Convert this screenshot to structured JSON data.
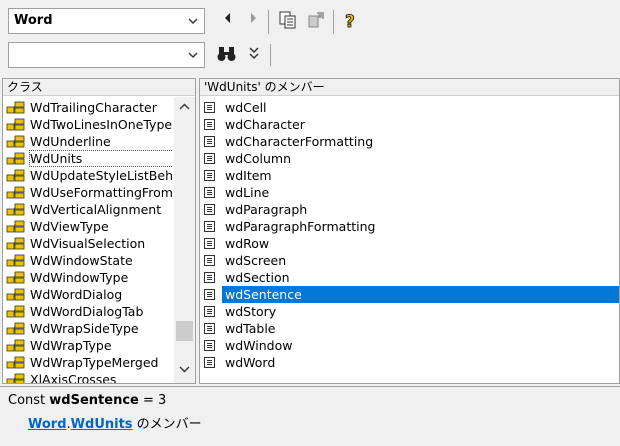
{
  "toolbar1": {
    "library_combo_value": "Word"
  },
  "toolbar2": {
    "search_value": ""
  },
  "classes": {
    "header": "クラス",
    "items": [
      "WdTrailingCharacter",
      "WdTwoLinesInOneType",
      "WdUnderline",
      "WdUnits",
      "WdUpdateStyleListBeh",
      "WdUseFormattingFrom",
      "WdVerticalAlignment",
      "WdViewType",
      "WdVisualSelection",
      "WdWindowState",
      "WdWindowType",
      "WdWordDialog",
      "WdWordDialogTab",
      "WdWrapSideType",
      "WdWrapType",
      "WdWrapTypeMerged",
      "XlAxisCrosses"
    ],
    "selected_index": 3
  },
  "members": {
    "header": "'WdUnits' のメンバー",
    "items": [
      "wdCell",
      "wdCharacter",
      "wdCharacterFormatting",
      "wdColumn",
      "wdItem",
      "wdLine",
      "wdParagraph",
      "wdParagraphFormatting",
      "wdRow",
      "wdScreen",
      "wdSection",
      "wdSentence",
      "wdStory",
      "wdTable",
      "wdWindow",
      "wdWord"
    ],
    "selected_index": 11
  },
  "details": {
    "const_prefix": "Const ",
    "const_name": "wdSentence",
    "const_value": " = 3",
    "library_link": "Word",
    "dot": ".",
    "class_link": "WdUnits",
    "member_of": " のメンバー"
  },
  "colors": {
    "selection": "#0078d7",
    "link": "#0066cc"
  }
}
